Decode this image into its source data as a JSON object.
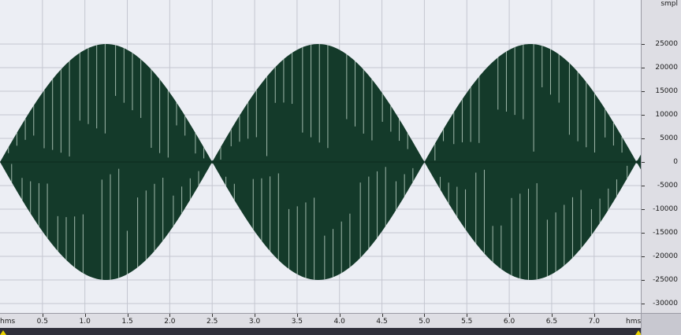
{
  "window": {
    "y_unit": "smpl",
    "x_unit": "hms",
    "accent": "#e8d200"
  },
  "chart_data": {
    "type": "area",
    "series": [
      {
        "color": "#143a2a"
      }
    ],
    "envelope": {
      "peak_amplitude": 25000,
      "period_hms": 2.5,
      "x_range": [
        0,
        7.55
      ]
    },
    "xlim": [
      0,
      7.55
    ],
    "ylim": [
      -32000,
      32000
    ],
    "y_ticks": [
      25000,
      20000,
      15000,
      10000,
      5000,
      0,
      -5000,
      -10000,
      -15000,
      -20000,
      -25000,
      -30000
    ],
    "y_tick_labels": [
      "25000",
      "20000",
      "15000",
      "10000",
      "5000",
      "0",
      "-5000",
      "-10000",
      "-15000",
      "-20000",
      "-25000",
      "-30000"
    ],
    "x_ticks": [
      0.5,
      1.0,
      1.5,
      2.0,
      2.5,
      3.0,
      3.5,
      4.0,
      4.5,
      5.0,
      5.5,
      6.0,
      6.5,
      7.0
    ],
    "x_tick_labels": [
      "0.5",
      "1.0",
      "1.5",
      "2.0",
      "2.5",
      "3.0",
      "3.5",
      "4.0",
      "4.5",
      "5.0",
      "5.5",
      "6.0",
      "6.5",
      "7.0"
    ],
    "grid": true,
    "colors": {
      "plot_bg": "#eceef4",
      "grid": "#c4c6d0",
      "wave": "#143a2a"
    }
  }
}
